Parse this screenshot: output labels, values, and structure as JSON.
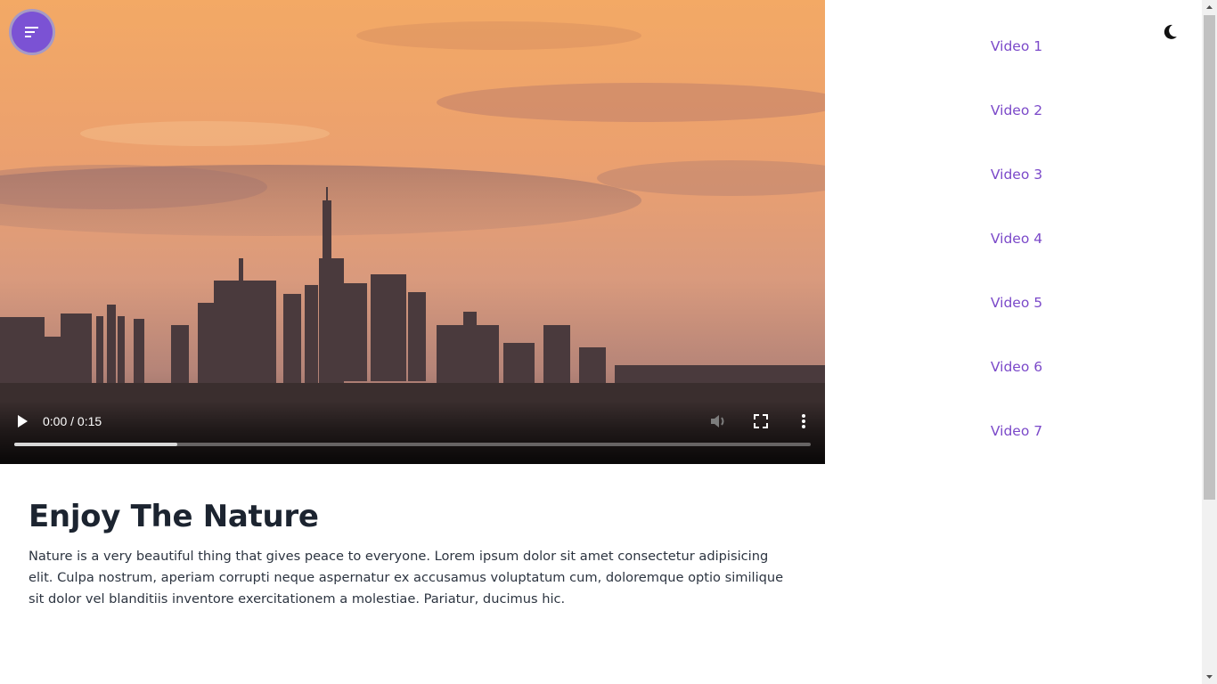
{
  "video": {
    "time_display": "0:00 / 0:15",
    "progress_fraction": 0.205,
    "icons": {
      "menu": "sort-lines-icon",
      "play": "play-icon",
      "volume": "volume-icon",
      "fullscreen": "fullscreen-icon",
      "more": "more-vertical-icon"
    }
  },
  "content": {
    "title": "Enjoy The Nature",
    "description": "Nature is a very beautiful thing that gives peace to everyone. Lorem ipsum dolor sit amet consectetur adipisicing elit. Culpa nostrum, aperiam corrupti neque aspernatur ex accusamus voluptatum cum, doloremque optio similique sit dolor vel blanditiis inventore exercitationem a molestiae. Pariatur, ducimus hic."
  },
  "playlist": {
    "items": [
      "Video 1",
      "Video 2",
      "Video 3",
      "Video 4",
      "Video 5",
      "Video 6",
      "Video 7"
    ]
  },
  "theme_toggle": {
    "icon": "moon-icon"
  },
  "colors": {
    "accent": "#7b52d4",
    "playlist_link": "#7b49c9",
    "title": "#1c2430",
    "text": "#2c3440"
  }
}
